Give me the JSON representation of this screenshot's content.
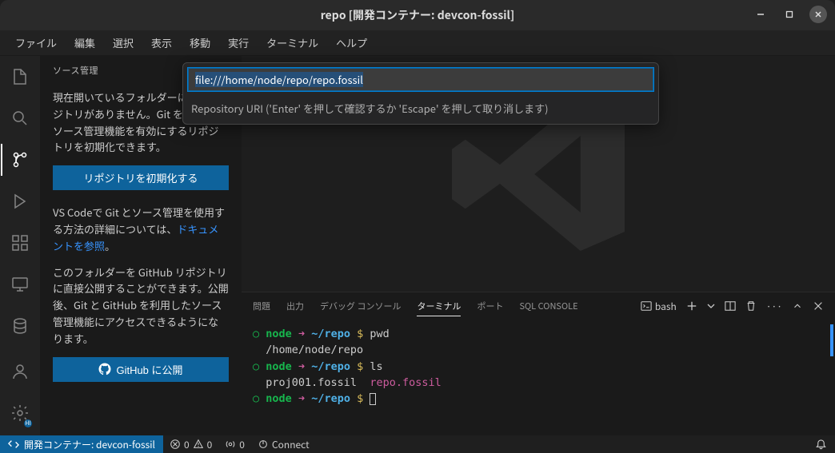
{
  "titlebar": {
    "title": "repo [開発コンテナー: devcon-fossil]"
  },
  "menu": {
    "items": [
      "ファイル",
      "編集",
      "選択",
      "表示",
      "移動",
      "実行",
      "ターミナル",
      "ヘルプ"
    ]
  },
  "sidebar": {
    "title": "ソース管理",
    "para1": "現在開いているフォルダーに Git リポジトリがありません。Git を利用したソース管理機能を有効にするリポジトリを初期化できます。",
    "init_btn": "リポジトリを初期化する",
    "para2_prefix": "VS Codeで Git とソース管理を使用する方法の詳細については、",
    "para2_link": "ドキュメントを参照",
    "para2_suffix": "。",
    "para3": "このフォルダーを GitHub リポジトリに直接公開することができます。公開後、Git と GitHub を利用したソース管理機能にアクセスできるようになります。",
    "github_btn": "GitHub に公開"
  },
  "quick_input": {
    "value": "file:///home/node/repo/repo.fossil",
    "hint": "Repository URI ('Enter' を押して確認するか 'Escape' を押して取り消します)"
  },
  "panel": {
    "tabs": {
      "problems": "問題",
      "output": "出力",
      "debug": "デバッグ コンソール",
      "terminal": "ターミナル",
      "ports": "ポート",
      "sql": "SQL CONSOLE"
    },
    "shell_label": "bash"
  },
  "terminal": {
    "prompt_user": "node",
    "prompt_arrow": "➜",
    "prompt_path": "~/repo",
    "prompt_symbol": "$",
    "cmd1": "pwd",
    "out1": "/home/node/repo",
    "cmd2": "ls",
    "out2a": "proj001.fossil",
    "out2b": "repo.fossil"
  },
  "status": {
    "remote": "開発コンテナー: devcon-fossil",
    "errors": "0",
    "warnings": "0",
    "ports": "0",
    "connect": "Connect"
  }
}
